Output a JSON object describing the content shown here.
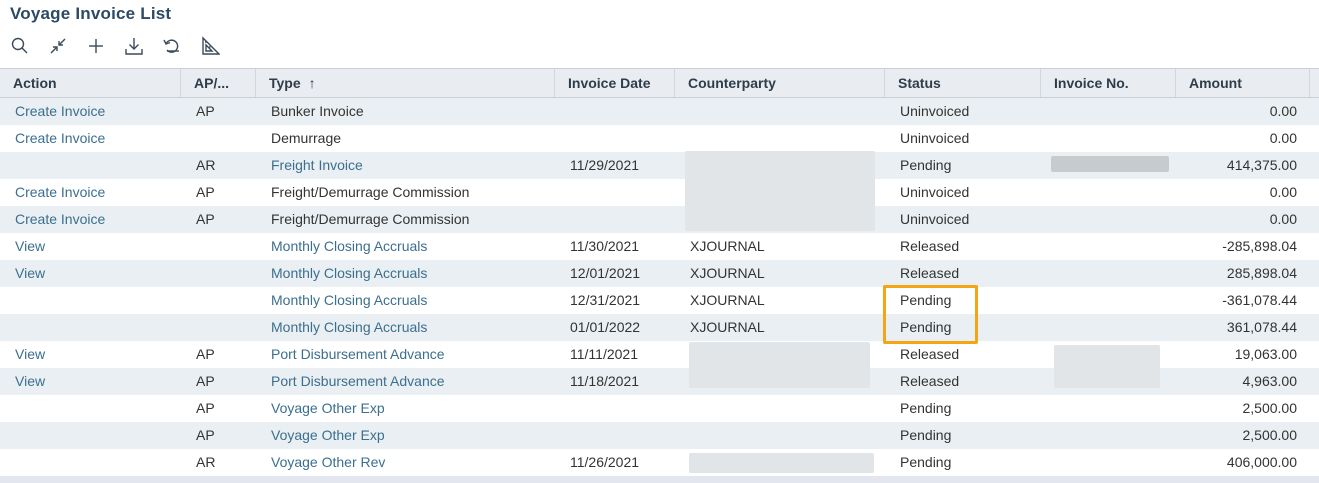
{
  "page": {
    "title": "Voyage Invoice List"
  },
  "toolbar": {
    "buttons": [
      {
        "icon": "search-icon"
      },
      {
        "icon": "collapse-icon"
      },
      {
        "icon": "add-icon"
      },
      {
        "icon": "download-icon"
      },
      {
        "icon": "undo-icon"
      },
      {
        "icon": "set-square-icon"
      }
    ]
  },
  "grid": {
    "columns": {
      "action": "Action",
      "ap_ar": "AP/...",
      "type": "Type",
      "type_sort": "↑",
      "invoice_date": "Invoice Date",
      "counterparty": "Counterparty",
      "status": "Status",
      "invoice_no": "Invoice No.",
      "amount": "Amount"
    },
    "rows": [
      {
        "action": "Create Invoice",
        "apar": "AP",
        "type": "Bunker Invoice",
        "type_link": false,
        "date": "",
        "counterparty": "",
        "status": "Uninvoiced",
        "invoice_no": "",
        "amount": "0.00"
      },
      {
        "action": "Create Invoice",
        "apar": "",
        "type": "Demurrage",
        "type_link": false,
        "date": "",
        "counterparty": "",
        "status": "Uninvoiced",
        "invoice_no": "",
        "amount": "0.00"
      },
      {
        "action": "",
        "apar": "AR",
        "type": "Freight Invoice",
        "type_link": true,
        "date": "11/29/2021",
        "counterparty": "",
        "status": "Pending",
        "invoice_no": "",
        "amount": "414,375.00"
      },
      {
        "action": "Create Invoice",
        "apar": "AP",
        "type": "Freight/Demurrage Commission",
        "type_link": false,
        "date": "",
        "counterparty": "",
        "status": "Uninvoiced",
        "invoice_no": "",
        "amount": "0.00"
      },
      {
        "action": "Create Invoice",
        "apar": "AP",
        "type": "Freight/Demurrage Commission",
        "type_link": false,
        "date": "",
        "counterparty": "",
        "status": "Uninvoiced",
        "invoice_no": "",
        "amount": "0.00"
      },
      {
        "action": "View",
        "apar": "",
        "type": "Monthly Closing Accruals",
        "type_link": true,
        "date": "11/30/2021",
        "counterparty": "XJOURNAL",
        "status": "Released",
        "invoice_no": "",
        "amount": "-285,898.04"
      },
      {
        "action": "View",
        "apar": "",
        "type": "Monthly Closing Accruals",
        "type_link": true,
        "date": "12/01/2021",
        "counterparty": "XJOURNAL",
        "status": "Released",
        "invoice_no": "",
        "amount": "285,898.04"
      },
      {
        "action": "",
        "apar": "",
        "type": "Monthly Closing Accruals",
        "type_link": true,
        "date": "12/31/2021",
        "counterparty": "XJOURNAL",
        "status": "Pending",
        "invoice_no": "",
        "amount": "-361,078.44"
      },
      {
        "action": "",
        "apar": "",
        "type": "Monthly Closing Accruals",
        "type_link": true,
        "date": "01/01/2022",
        "counterparty": "XJOURNAL",
        "status": "Pending",
        "invoice_no": "",
        "amount": "361,078.44"
      },
      {
        "action": "View",
        "apar": "AP",
        "type": "Port Disbursement Advance",
        "type_link": true,
        "date": "11/11/2021",
        "counterparty": "",
        "status": "Released",
        "invoice_no": "",
        "amount": "19,063.00"
      },
      {
        "action": "View",
        "apar": "AP",
        "type": "Port Disbursement Advance",
        "type_link": true,
        "date": "11/18/2021",
        "counterparty": "",
        "status": "Released",
        "invoice_no": "",
        "amount": "4,963.00"
      },
      {
        "action": "",
        "apar": "AP",
        "type": "Voyage Other Exp",
        "type_link": true,
        "date": "",
        "counterparty": "",
        "status": "Pending",
        "invoice_no": "",
        "amount": "2,500.00"
      },
      {
        "action": "",
        "apar": "AP",
        "type": "Voyage Other Exp",
        "type_link": true,
        "date": "",
        "counterparty": "",
        "status": "Pending",
        "invoice_no": "",
        "amount": "2,500.00"
      },
      {
        "action": "",
        "apar": "AR",
        "type": "Voyage Other Rev",
        "type_link": true,
        "date": "11/26/2021",
        "counterparty": "",
        "status": "Pending",
        "invoice_no": "",
        "amount": "406,000.00"
      }
    ]
  },
  "colors": {
    "highlight": "#f2a515",
    "link": "#3c6f8e",
    "title": "#2c4a63"
  }
}
